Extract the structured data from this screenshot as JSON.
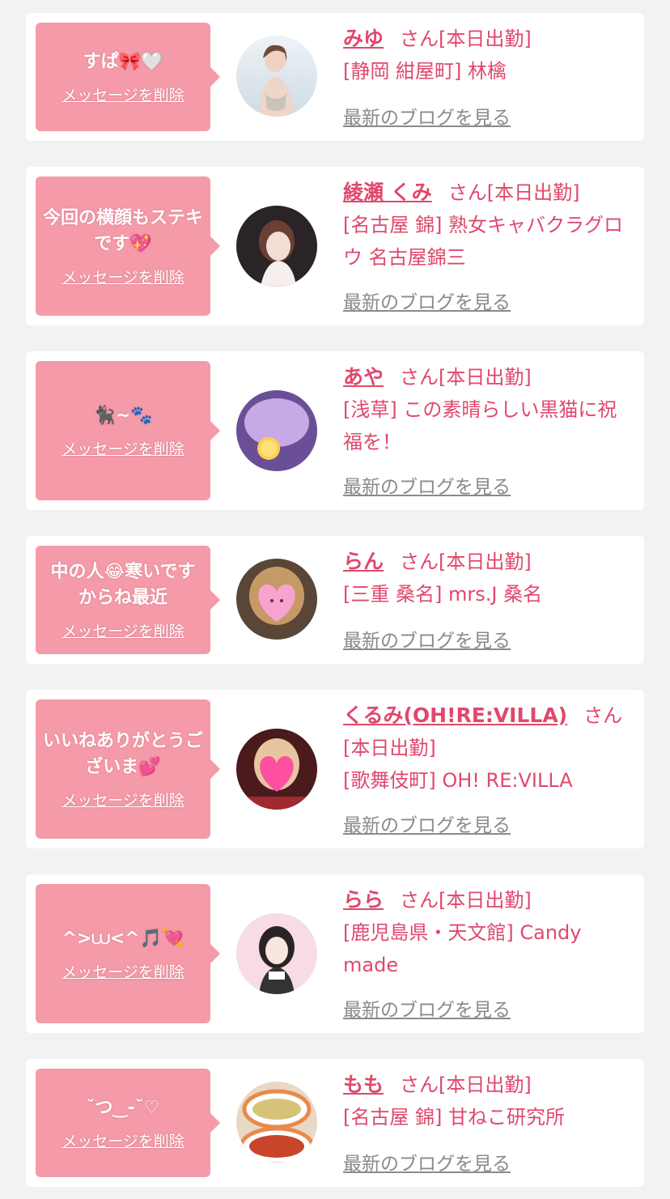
{
  "delete_label": "メッセージを削除",
  "blog_label": "最新のブログを見る",
  "san_label": "さん",
  "colors": {
    "background": "#f2f2f2",
    "bubble": "#f59aa8",
    "accent": "#e0486c",
    "link_gray": "#8a8a8a"
  },
  "items": [
    {
      "message": "すぱ🎀🤍",
      "name": "みゆ",
      "status": "[本日出勤]",
      "shop": "[静岡 紺屋町] 林檎"
    },
    {
      "message": "今回の横顔もステキです💖",
      "name": "綾瀬 くみ",
      "status": "[本日出勤]",
      "shop": "[名古屋 錦] 熟女キャバクラグロウ 名古屋錦三"
    },
    {
      "message": "🐈‍⬛~🐾",
      "name": "あや",
      "status": "[本日出勤]",
      "shop": "[浅草] この素晴らしい黒猫に祝福を！"
    },
    {
      "message": "中の人😂寒いですからね最近",
      "name": "らん",
      "status": "[本日出勤]",
      "shop": "[三重 桑名] mrs.J 桑名"
    },
    {
      "message": "いいねありがとうございま💕",
      "name": "くるみ(OH!RE:VILLA)",
      "status": "[本日出勤]",
      "shop": "[歌舞伎町] OH! RE:VILLA"
    },
    {
      "message": "^>⩊<^🎵💘",
      "name": "らら",
      "status": "[本日出勤]",
      "shop": "[鹿児島県・天文館] Candy made"
    },
    {
      "message": "˘つ‿-˘♡",
      "name": "もも",
      "status": "[本日出勤]",
      "shop": "[名古屋 錦] 甘ねこ研究所"
    }
  ]
}
